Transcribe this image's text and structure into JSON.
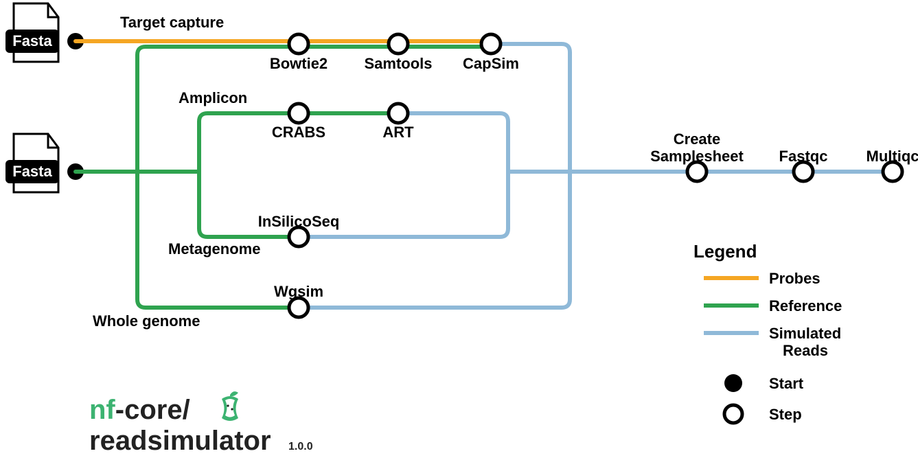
{
  "files": {
    "fasta1": "Fasta",
    "fasta2": "Fasta"
  },
  "branches": {
    "target_capture": "Target capture",
    "amplicon": "Amplicon",
    "metagenome": "Metagenome",
    "whole_genome": "Whole genome"
  },
  "steps": {
    "bowtie2": "Bowtie2",
    "samtools": "Samtools",
    "capsim": "CapSim",
    "crabs": "CRABS",
    "art": "ART",
    "insilicoseq": "InSilicoSeq",
    "wgsim": "Wgsim",
    "create_samplesheet_line1": "Create",
    "create_samplesheet_line2": "Samplesheet",
    "fastqc": "Fastqc",
    "multiqc": "Multiqc"
  },
  "legend": {
    "title": "Legend",
    "probes": "Probes",
    "reference": "Reference",
    "simulated_reads_l1": "Simulated",
    "simulated_reads_l2": "Reads",
    "start": "Start",
    "step": "Step"
  },
  "logo": {
    "nf": "nf",
    "dash_core_slash": "-core/",
    "subtitle": "readsimulator",
    "version": "1.0.0"
  },
  "colors": {
    "probes": "#f5a623",
    "reference": "#2fa34f",
    "simulated": "#8fb9d8",
    "black": "#000"
  },
  "chart_data": {
    "type": "flow-diagram",
    "inputs": [
      {
        "id": "fasta-probes",
        "label": "Fasta",
        "stream": "Probes"
      },
      {
        "id": "fasta-reference",
        "label": "Fasta",
        "stream": "Reference"
      }
    ],
    "branches": [
      {
        "name": "Target capture",
        "input_streams": [
          "Probes",
          "Reference"
        ],
        "steps": [
          "Bowtie2",
          "Samtools",
          "CapSim"
        ],
        "output_stream": "Simulated Reads"
      },
      {
        "name": "Amplicon",
        "input_streams": [
          "Reference"
        ],
        "steps": [
          "CRABS",
          "ART"
        ],
        "output_stream": "Simulated Reads"
      },
      {
        "name": "Metagenome",
        "input_streams": [
          "Reference"
        ],
        "steps": [
          "InSilicoSeq"
        ],
        "output_stream": "Simulated Reads"
      },
      {
        "name": "Whole genome",
        "input_streams": [
          "Reference"
        ],
        "steps": [
          "Wgsim"
        ],
        "output_stream": "Simulated Reads"
      }
    ],
    "post_steps": [
      "Create Samplesheet",
      "Fastqc",
      "Multiqc"
    ],
    "legend": [
      {
        "label": "Probes",
        "kind": "line",
        "color": "#f5a623"
      },
      {
        "label": "Reference",
        "kind": "line",
        "color": "#2fa34f"
      },
      {
        "label": "Simulated Reads",
        "kind": "line",
        "color": "#8fb9d8"
      },
      {
        "label": "Start",
        "kind": "filled-circle"
      },
      {
        "label": "Step",
        "kind": "hollow-circle"
      }
    ],
    "project": "nf-core/readsimulator",
    "version": "1.0.0"
  }
}
